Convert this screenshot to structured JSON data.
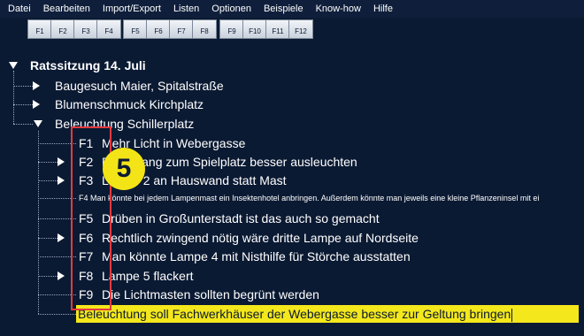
{
  "menu": [
    "Datei",
    "Bearbeiten",
    "Import/Export",
    "Listen",
    "Optionen",
    "Beispiele",
    "Know-how",
    "Hilfe"
  ],
  "fkeys": [
    "F1",
    "F2",
    "F3",
    "F4",
    "F5",
    "F6",
    "F7",
    "F8",
    "F9",
    "F10",
    "F11",
    "F12"
  ],
  "tree": {
    "root": "Ratssitzung 14. Juli",
    "items": [
      {
        "label": "Baugesuch Maier, Spitalstraße"
      },
      {
        "label": "Blumenschmuck Kirchplatz"
      },
      {
        "label": "Beleuchtung Schillerplatz"
      }
    ],
    "children": [
      {
        "code": "F1",
        "text": "Mehr Licht in Webergasse"
      },
      {
        "code": "F2",
        "text": "Durchgang zum Spielplatz besser ausleuchten"
      },
      {
        "code": "F3",
        "text": "Lampe 2 an Hauswand statt Mast"
      },
      {
        "code": "F4",
        "text": "Man könnte bei jedem Lampenmast ein Insektenhotel anbringen. Außerdem könnte man jeweils eine kleine Pflanzeninsel mit ei"
      },
      {
        "code": "F5",
        "text": "Drüben in Großunterstadt ist das auch so gemacht"
      },
      {
        "code": "F6",
        "text": "Rechtlich zwingend nötig wäre dritte Lampe auf Nordseite"
      },
      {
        "code": "F7",
        "text": "Man könnte Lampe 4 mit Nisthilfe für Störche ausstatten"
      },
      {
        "code": "F8",
        "text": "Lampe 5 flackert"
      },
      {
        "code": "F9",
        "text": "Die Lichtmasten sollten begrünt werden"
      }
    ],
    "edit_value": "Beleuchtung soll Fachwerkhäuser der Webergasse besser zur Geltung bringen"
  },
  "annotation": {
    "step": "5"
  }
}
